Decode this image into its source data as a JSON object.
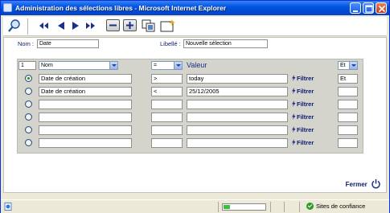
{
  "window": {
    "title": "Administration des sélections libres - Microsoft Internet Explorer",
    "title_color": "#0055e5"
  },
  "toolbar": {
    "buttons": [
      "magnifier-icon",
      "first-icon",
      "prev-icon",
      "next-icon",
      "last-icon",
      "minus-icon",
      "plus-icon",
      "copy-icon",
      "new-icon"
    ]
  },
  "header": {
    "nom_label": "Nom :",
    "nom_value": "Date",
    "libelle_label": "Libellé :",
    "libelle_value": "Nouvelle sélection"
  },
  "grid": {
    "index": "1",
    "field_select": "Nom",
    "operator_select": "=",
    "valeur_label": "Valeur",
    "logic_select": "Et",
    "filter_label": "Filtrer",
    "rows": [
      {
        "selected": true,
        "field": "Date de création",
        "operator": ">",
        "value": "today",
        "logic": "Et"
      },
      {
        "selected": false,
        "field": "Date de création",
        "operator": "<",
        "value": "25/12/2005",
        "logic": ""
      },
      {
        "selected": false,
        "field": "",
        "operator": "",
        "value": "",
        "logic": ""
      },
      {
        "selected": false,
        "field": "",
        "operator": "",
        "value": "",
        "logic": ""
      },
      {
        "selected": false,
        "field": "",
        "operator": "",
        "value": "",
        "logic": ""
      },
      {
        "selected": false,
        "field": "",
        "operator": "",
        "value": "",
        "logic": ""
      }
    ]
  },
  "footer": {
    "close_label": "Fermer"
  },
  "statusbar": {
    "progress": 0.15,
    "zone_label": "Sites de confiance"
  }
}
